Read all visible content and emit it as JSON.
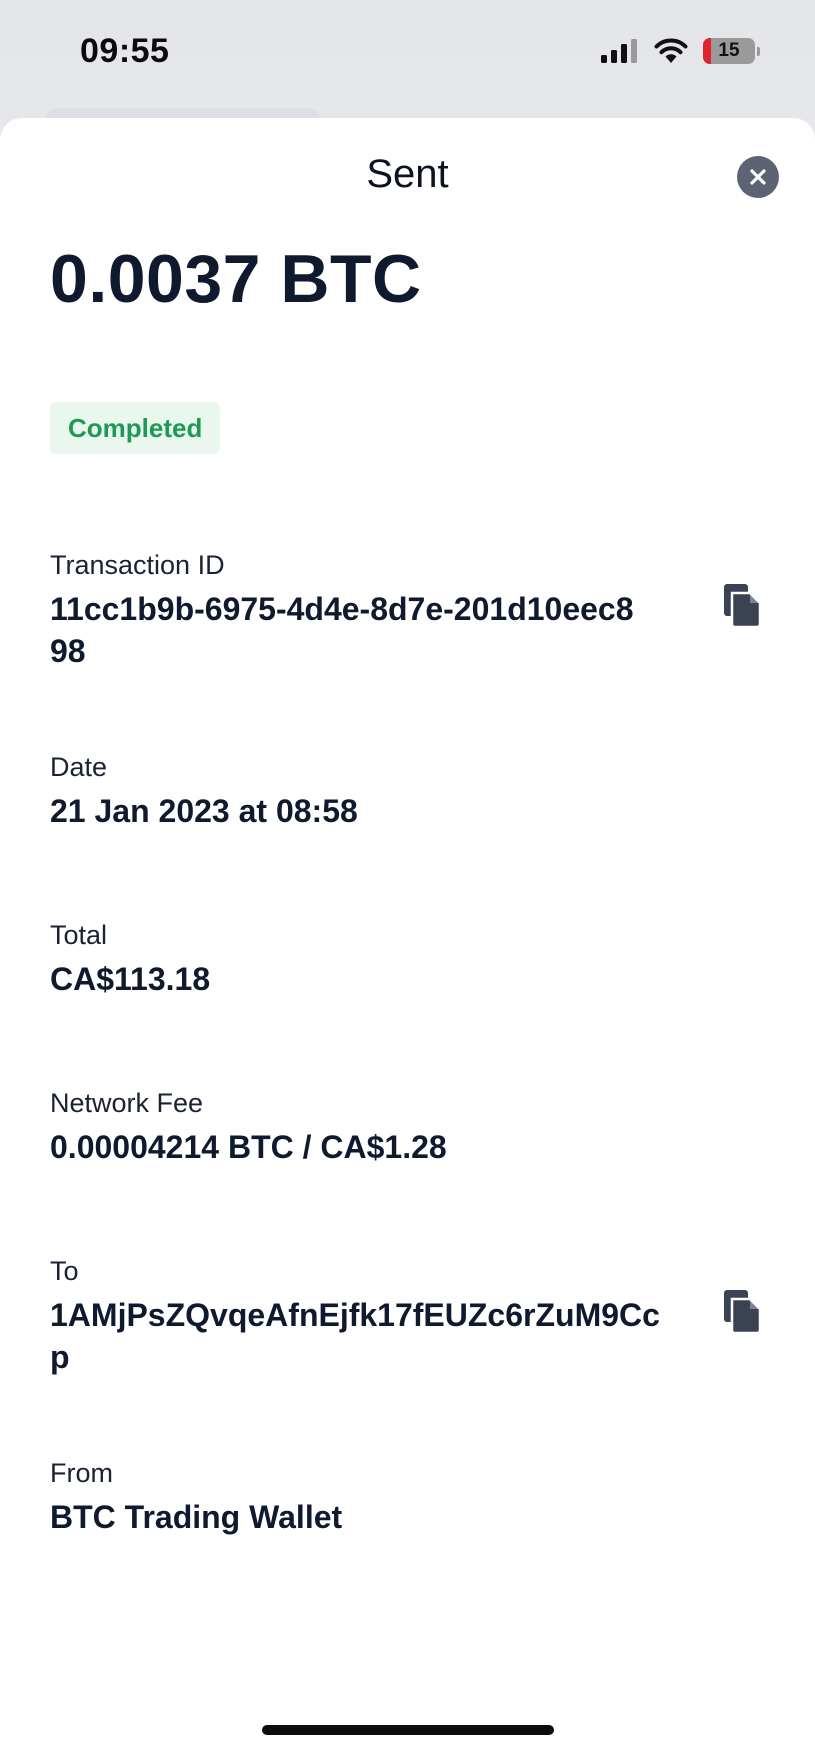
{
  "status_bar": {
    "time": "09:55",
    "battery": "15",
    "icons": [
      "signal-icon",
      "wifi-icon",
      "battery-icon"
    ]
  },
  "sheet": {
    "title": "Sent",
    "close_icon": "close-icon",
    "amount": "0.0037 BTC",
    "status": "Completed",
    "transaction_id": {
      "label": "Transaction ID",
      "value_line1": "11cc1b9b-6975-4d4e-8d7e-201d10eec8",
      "value_line2": "98"
    },
    "date": {
      "label": "Date",
      "value": "21 Jan 2023 at 08:58"
    },
    "total": {
      "label": "Total",
      "value": "CA$113.18"
    },
    "network_fee": {
      "label": "Network Fee",
      "value": "0.00004214 BTC / CA$1.28"
    },
    "to": {
      "label": "To",
      "value_line1": "1AMjPsZQvqeAfnEjfk17fEUZc6rZuM9Cc",
      "value_line2": "p"
    },
    "from": {
      "label": "From",
      "value": "BTC Trading Wallet"
    }
  },
  "colors": {
    "text_primary": "#0f1a2e",
    "status_green": "#1e9a54",
    "status_green_bg": "#eaf7ef",
    "close_button": "#5d6373",
    "battery_low": "#e0242a"
  }
}
